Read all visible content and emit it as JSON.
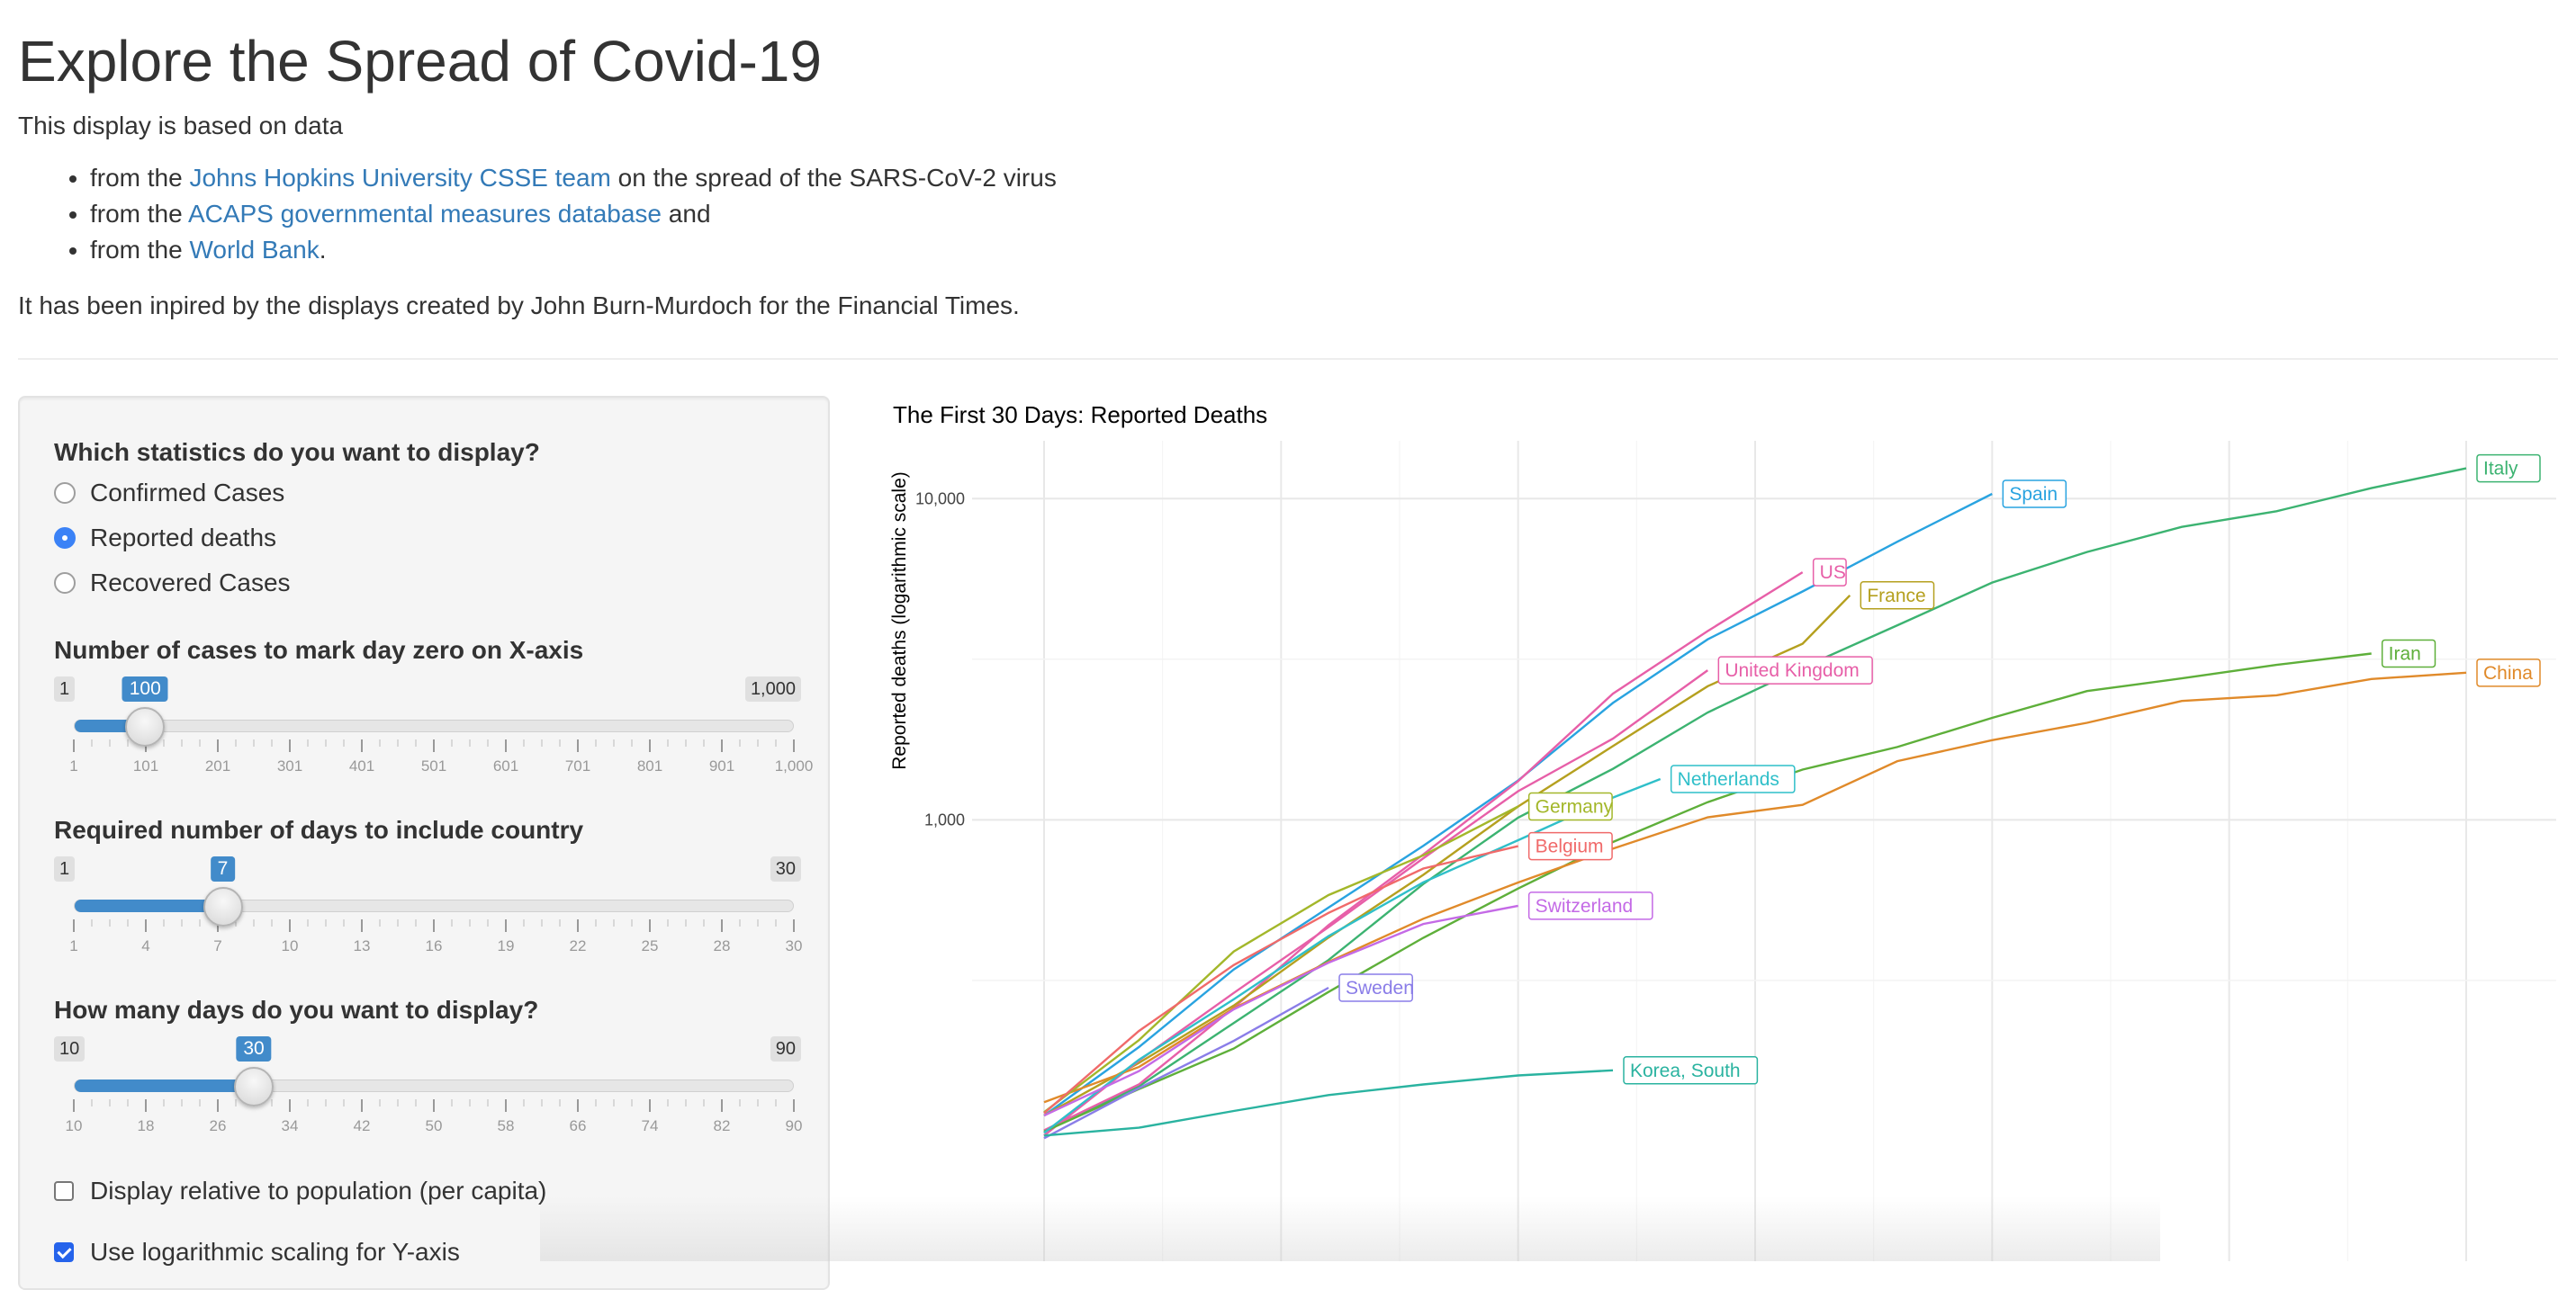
{
  "page": {
    "title": "Explore the Spread of Covid-19",
    "intro": "This display is based on data",
    "sources": [
      {
        "prefix": "from the ",
        "link": "Johns Hopkins University CSSE team",
        "suffix": " on the spread of the SARS-CoV-2 virus"
      },
      {
        "prefix": "from the ",
        "link": "ACAPS governmental measures database",
        "suffix": " and"
      },
      {
        "prefix": "from the ",
        "link": "World Bank",
        "suffix": "."
      }
    ],
    "inspired": "It has been inpired by the displays created by John Burn-Murdoch for the Financial Times."
  },
  "sidebar": {
    "stat_question": "Which statistics do you want to display?",
    "stat_options": [
      {
        "label": "Confirmed Cases",
        "selected": false
      },
      {
        "label": "Reported deaths",
        "selected": true
      },
      {
        "label": "Recovered Cases",
        "selected": false
      }
    ],
    "zero_slider": {
      "label": "Number of cases to mark day zero on X-axis",
      "min": 1,
      "max": 1000,
      "value": 100,
      "min_label": "1",
      "max_label": "1,000",
      "value_label": "100",
      "ticks": [
        "1",
        "101",
        "201",
        "301",
        "401",
        "501",
        "601",
        "701",
        "801",
        "901",
        "1,000"
      ]
    },
    "days_req_slider": {
      "label": "Required number of days to include country",
      "min": 1,
      "max": 30,
      "value": 7,
      "min_label": "1",
      "max_label": "30",
      "value_label": "7",
      "ticks": [
        "1",
        "4",
        "7",
        "10",
        "13",
        "16",
        "19",
        "22",
        "25",
        "28",
        "30"
      ]
    },
    "days_show_slider": {
      "label": "How many days do you want to display?",
      "min": 10,
      "max": 90,
      "value": 30,
      "min_label": "10",
      "max_label": "90",
      "value_label": "30",
      "ticks": [
        "10",
        "18",
        "26",
        "34",
        "42",
        "50",
        "58",
        "66",
        "74",
        "82",
        "90"
      ]
    },
    "per_capita": {
      "label": "Display relative to population (per capita)",
      "checked": false
    },
    "log_scale": {
      "label": "Use logarithmic scaling for Y-axis",
      "checked": true
    }
  },
  "chart_data": {
    "type": "line",
    "title": "The First 30 Days: Reported Deaths",
    "ylabel": "Reported deaths (logarithmic scale)",
    "xlabel": "",
    "y_scale": "log",
    "y_ticks": [
      "1,000",
      "10,000"
    ],
    "x_range": [
      0,
      30
    ],
    "grid": true,
    "series": [
      {
        "name": "Italy",
        "color": "#3cb371",
        "x": [
          0,
          2,
          4,
          6,
          8,
          10,
          12,
          14,
          16,
          18,
          20,
          22,
          24,
          26,
          28,
          30
        ],
        "values": [
          107,
          148,
          233,
          366,
          631,
          1016,
          1441,
          2158,
          2978,
          4032,
          5476,
          6820,
          8165,
          9134,
          10779,
          12428
        ]
      },
      {
        "name": "Spain",
        "color": "#29a3e0",
        "x": [
          0,
          2,
          4,
          6,
          8,
          10,
          12,
          14,
          16,
          18,
          20
        ],
        "values": [
          120,
          196,
          342,
          533,
          830,
          1326,
          2311,
          3647,
          5138,
          7340,
          10348
        ]
      },
      {
        "name": "US",
        "color": "#e75fa8",
        "x": [
          0,
          2,
          4,
          6,
          8,
          10,
          12,
          14,
          16
        ],
        "values": [
          108,
          150,
          260,
          470,
          780,
          1320,
          2470,
          3870,
          5900
        ]
      },
      {
        "name": "France",
        "color": "#b5a01f",
        "x": [
          0,
          2,
          4,
          6,
          8,
          10,
          12,
          14,
          16,
          17
        ],
        "values": [
          120,
          175,
          264,
          430,
          674,
          1100,
          1696,
          2606,
          3532,
          5000
        ]
      },
      {
        "name": "United Kingdom",
        "color": "#e75fa8",
        "x": [
          0,
          2,
          4,
          6,
          8,
          10,
          12,
          14
        ],
        "values": [
          104,
          178,
          289,
          463,
          759,
          1228,
          1789,
          2921
        ]
      },
      {
        "name": "Iran",
        "color": "#5eaf3a",
        "x": [
          0,
          2,
          4,
          6,
          8,
          10,
          12,
          14,
          16,
          18,
          20,
          22,
          24,
          26,
          28
        ],
        "values": [
          107,
          145,
          194,
          291,
          429,
          611,
          853,
          1135,
          1433,
          1685,
          2077,
          2517,
          2757,
          3036,
          3294
        ]
      },
      {
        "name": "China",
        "color": "#e08a2a",
        "x": [
          0,
          2,
          4,
          6,
          8,
          10,
          12,
          14,
          16,
          18,
          20,
          22,
          24,
          26,
          28,
          30
        ],
        "values": [
          132,
          170,
          259,
          361,
          492,
          638,
          813,
          1018,
          1113,
          1523,
          1770,
          2004,
          2345,
          2442,
          2744,
          2870
        ]
      },
      {
        "name": "Netherlands",
        "color": "#2fbfc9",
        "x": [
          0,
          2,
          4,
          6,
          8,
          10,
          12,
          13
        ],
        "values": [
          106,
          179,
          276,
          434,
          639,
          864,
          1173,
          1339
        ]
      },
      {
        "name": "Germany",
        "color": "#a3b72a",
        "x": [
          0,
          2,
          4,
          6,
          8,
          10
        ],
        "values": [
          123,
          206,
          389,
          583,
          775,
          1100
        ]
      },
      {
        "name": "Belgium",
        "color": "#f06a6a",
        "x": [
          0,
          2,
          4,
          6,
          8,
          10
        ],
        "values": [
          122,
          220,
          353,
          513,
          705,
          828
        ]
      },
      {
        "name": "Switzerland",
        "color": "#c46ae6",
        "x": [
          0,
          2,
          4,
          6,
          8,
          10
        ],
        "values": [
          120,
          165,
          257,
          359,
          474,
          540
        ]
      },
      {
        "name": "Sweden",
        "color": "#8a7de8",
        "x": [
          0,
          2,
          4,
          6
        ],
        "values": [
          102,
          146,
          205,
          300
        ]
      },
      {
        "name": "Korea, South",
        "color": "#2ab3a0",
        "x": [
          0,
          2,
          4,
          6,
          8,
          10,
          12
        ],
        "values": [
          104,
          110,
          124,
          139,
          150,
          160,
          166
        ]
      }
    ]
  }
}
